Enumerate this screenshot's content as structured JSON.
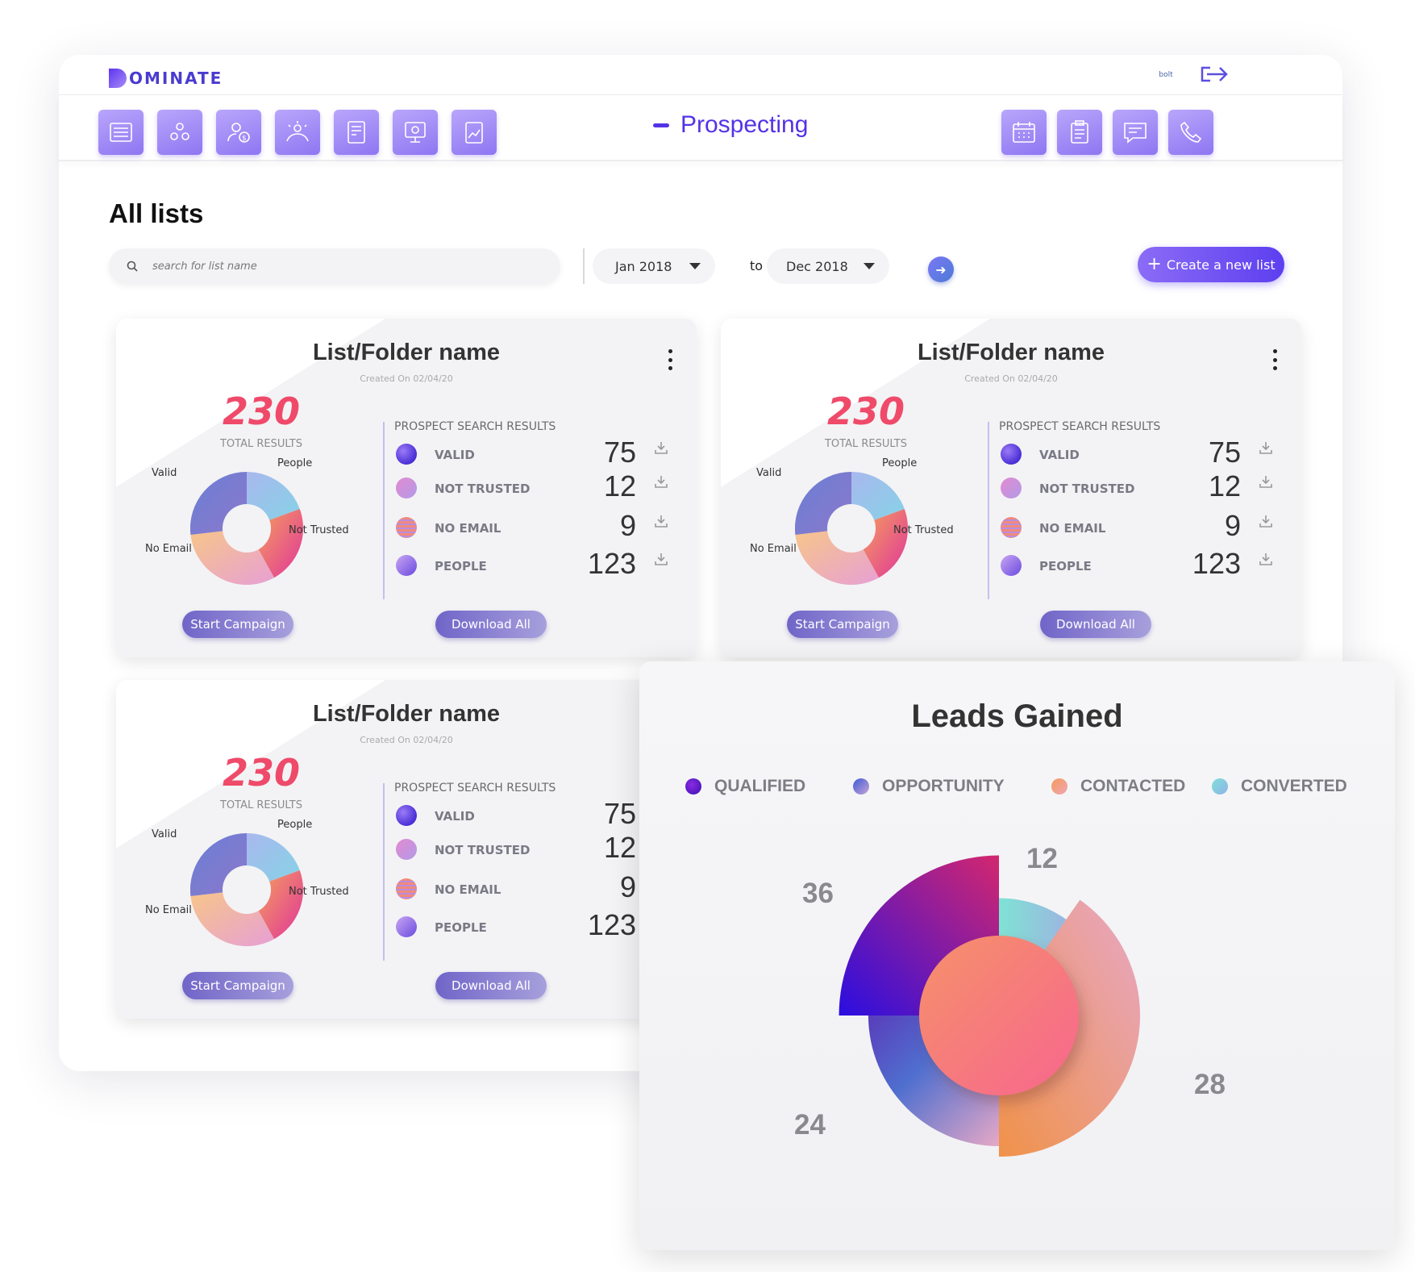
{
  "app": {
    "logo_text": "OMINATE",
    "logo_letter": "D",
    "avatar_text": "bolt",
    "page_title": "Prospecting",
    "nav_icons": [
      "list-icon",
      "team-icon",
      "finance-icon",
      "audience-icon",
      "billing-icon",
      "presentation-icon",
      "reports-icon"
    ],
    "right_icons": [
      "calendar-icon",
      "clipboard-icon",
      "chat-icon",
      "phone-icon"
    ]
  },
  "main": {
    "heading": "All lists",
    "search_placeholder": "search for list name",
    "date_from": "Jan 2018",
    "date_to": "Dec 2018",
    "to_label": "to",
    "create_label": "Create a new list"
  },
  "cards": [
    {
      "title": "List/Folder name",
      "created": "Created On 02/04/20",
      "total": "230",
      "total_label": "TOTAL RESULTS",
      "psr_label": "PROSPECT SEARCH RESULTS",
      "pie_labels": {
        "valid": "Valid",
        "people": "People",
        "not_trusted": "Not Trusted",
        "no_email": "No Email"
      },
      "rows": [
        {
          "label": "VALID",
          "value": "75"
        },
        {
          "label": "NOT TRUSTED",
          "value": "12"
        },
        {
          "label": "NO EMAIL",
          "value": "9"
        },
        {
          "label": "PEOPLE",
          "value": "123"
        }
      ],
      "start_label": "Start Campaign",
      "download_label": "Download All"
    },
    {
      "title": "List/Folder name",
      "created": "Created On 02/04/20",
      "total": "230",
      "total_label": "TOTAL RESULTS",
      "psr_label": "PROSPECT SEARCH RESULTS",
      "pie_labels": {
        "valid": "Valid",
        "people": "People",
        "not_trusted": "Not Trusted",
        "no_email": "No Email"
      },
      "rows": [
        {
          "label": "VALID",
          "value": "75"
        },
        {
          "label": "NOT TRUSTED",
          "value": "12"
        },
        {
          "label": "NO EMAIL",
          "value": "9"
        },
        {
          "label": "PEOPLE",
          "value": "123"
        }
      ],
      "start_label": "Start Campaign",
      "download_label": "Download All"
    },
    {
      "title": "List/Folder name",
      "created": "Created On 02/04/20",
      "total": "230",
      "total_label": "TOTAL RESULTS",
      "psr_label": "PROSPECT SEARCH RESULTS",
      "pie_labels": {
        "valid": "Valid",
        "people": "People",
        "not_trusted": "Not Trusted",
        "no_email": "No Email"
      },
      "rows": [
        {
          "label": "VALID",
          "value": "75"
        },
        {
          "label": "NOT TRUSTED",
          "value": "12"
        },
        {
          "label": "NO EMAIL",
          "value": "9"
        },
        {
          "label": "PEOPLE",
          "value": "123"
        }
      ],
      "start_label": "Start Campaign",
      "download_label": "Download All"
    }
  ],
  "leads": {
    "title": "Leads Gained",
    "legend": [
      {
        "label": "QUALIFIED",
        "color": "#5b18d6"
      },
      {
        "label": "OPPORTUNITY",
        "color": "#6a6fcc"
      },
      {
        "label": "CONTACTED",
        "color": "#f1937a"
      },
      {
        "label": "CONVERTED",
        "color": "#7fd3e6"
      }
    ],
    "values": {
      "qualified": "36",
      "converted": "12",
      "contacted": "28",
      "opportunity": "24"
    }
  },
  "colors": {
    "accent": "#5433e6",
    "total": "#ef4a6a"
  }
}
